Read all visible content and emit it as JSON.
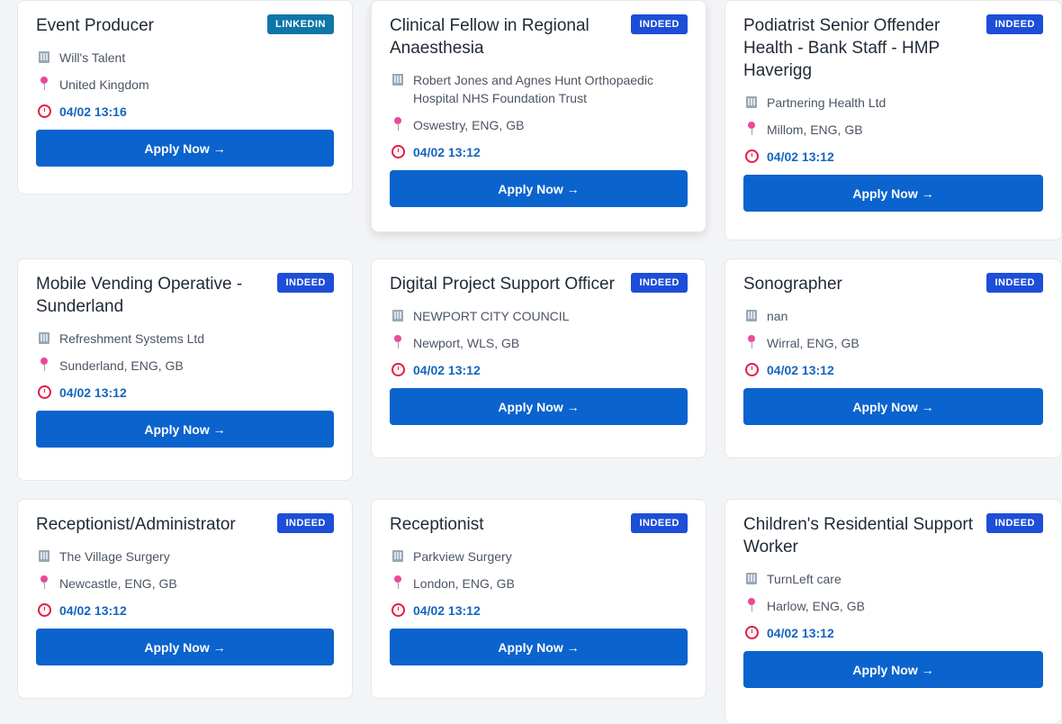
{
  "jobs": [
    {
      "title": "Event Producer",
      "source": "LINKEDIN",
      "company": "Will's Talent",
      "location": "United Kingdom",
      "posted": "04/02 13:16",
      "apply_label": "Apply Now →"
    },
    {
      "title": "Clinical Fellow in Regional Anaesthesia",
      "source": "INDEED",
      "company": "Robert Jones and Agnes Hunt Orthopaedic Hospital NHS Foundation Trust",
      "location": "Oswestry, ENG, GB",
      "posted": "04/02 13:12",
      "apply_label": "Apply Now →"
    },
    {
      "title": "Podiatrist Senior Offender Health - Bank Staff - HMP Haverigg",
      "source": "INDEED",
      "company": "Partnering Health Ltd",
      "location": "Millom, ENG, GB",
      "posted": "04/02 13:12",
      "apply_label": "Apply Now →"
    },
    {
      "title": "Mobile Vending Operative - Sunderland",
      "source": "INDEED",
      "company": "Refreshment Systems Ltd",
      "location": "Sunderland, ENG, GB",
      "posted": "04/02 13:12",
      "apply_label": "Apply Now →"
    },
    {
      "title": "Digital Project Support Officer",
      "source": "INDEED",
      "company": "NEWPORT CITY COUNCIL",
      "location": "Newport, WLS, GB",
      "posted": "04/02 13:12",
      "apply_label": "Apply Now →"
    },
    {
      "title": "Sonographer",
      "source": "INDEED",
      "company": "nan",
      "location": "Wirral, ENG, GB",
      "posted": "04/02 13:12",
      "apply_label": "Apply Now →"
    },
    {
      "title": "Receptionist/Administrator",
      "source": "INDEED",
      "company": "The Village Surgery",
      "location": "Newcastle, ENG, GB",
      "posted": "04/02 13:12",
      "apply_label": "Apply Now →"
    },
    {
      "title": "Receptionist",
      "source": "INDEED",
      "company": "Parkview Surgery",
      "location": "London, ENG, GB",
      "posted": "04/02 13:12",
      "apply_label": "Apply Now →"
    },
    {
      "title": "Children's Residential Support Worker",
      "source": "INDEED",
      "company": "TurnLeft care",
      "location": "Harlow, ENG, GB",
      "posted": "04/02 13:12",
      "apply_label": "Apply Now →"
    }
  ],
  "icons": {
    "company": "building-icon",
    "location": "pin-icon",
    "posted": "alarm-clock-icon"
  },
  "colors": {
    "apply_button": "#0b63ce",
    "badge_indeed": "#1d4ed8",
    "badge_linkedin": "#0e76a8",
    "posted_text": "#1565c0",
    "page_background": "#f3f4f6"
  }
}
